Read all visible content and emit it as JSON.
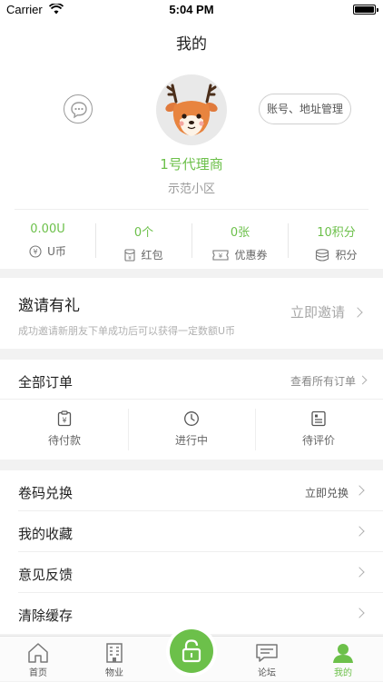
{
  "status_bar": {
    "carrier": "Carrier",
    "time": "5:04 PM"
  },
  "nav": {
    "title": "我的"
  },
  "profile": {
    "account_button": "账号、地址管理",
    "name": "1号代理商",
    "community": "示范小区"
  },
  "stats": [
    {
      "value": "0.00U",
      "label": "U币",
      "icon": "coin-icon"
    },
    {
      "value": "0个",
      "label": "红包",
      "icon": "red-packet-icon"
    },
    {
      "value": "0张",
      "label": "优惠券",
      "icon": "coupon-icon"
    },
    {
      "value": "10积分",
      "label": "积分",
      "icon": "points-icon"
    }
  ],
  "invite": {
    "title": "邀请有礼",
    "subtitle": "成功邀请新朋友下单成功后可以获得一定数额U币",
    "action": "立即邀请"
  },
  "orders": {
    "title": "全部订单",
    "view_all": "查看所有订单",
    "items": [
      {
        "label": "待付款",
        "icon": "pending-payment-icon"
      },
      {
        "label": "进行中",
        "icon": "clock-icon"
      },
      {
        "label": "待评价",
        "icon": "review-icon"
      }
    ]
  },
  "menu": [
    {
      "label": "卷码兑换",
      "action": "立即兑换"
    },
    {
      "label": "我的收藏",
      "action": ""
    },
    {
      "label": "意见反馈",
      "action": ""
    },
    {
      "label": "清除缓存",
      "action": ""
    }
  ],
  "tabbar": [
    {
      "label": "首页",
      "icon": "home-icon"
    },
    {
      "label": "物业",
      "icon": "building-icon"
    },
    {
      "label": "",
      "icon": "unlock-icon"
    },
    {
      "label": "论坛",
      "icon": "forum-icon"
    },
    {
      "label": "我的",
      "icon": "user-icon",
      "active": true
    }
  ],
  "colors": {
    "accent": "#6cc04a",
    "background": "#f2f2f2"
  }
}
